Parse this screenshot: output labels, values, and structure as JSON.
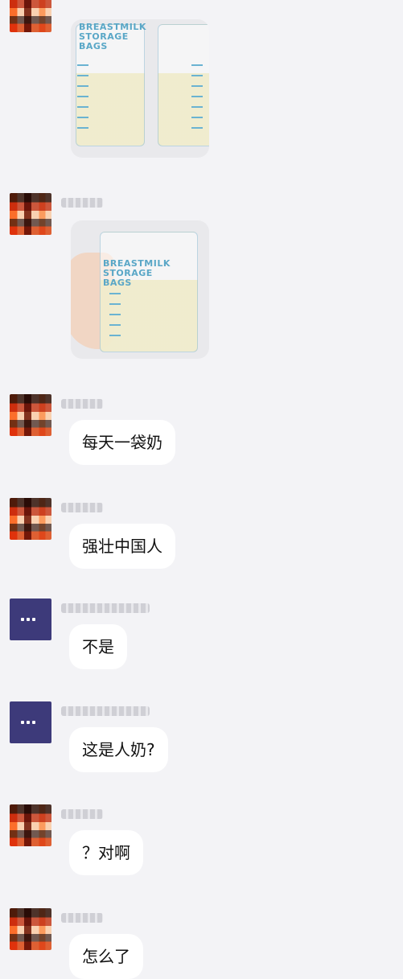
{
  "messages": [
    {
      "type": "image",
      "avatar": "pixelated-avatar",
      "image_text": "BREASTMILK STORAGE BAGS"
    },
    {
      "type": "image",
      "avatar": "pixelated-avatar",
      "image_text": "BREASTMILK STORAGE BAGS"
    },
    {
      "type": "text",
      "avatar": "pixelated-avatar",
      "text": "每天一袋奶"
    },
    {
      "type": "text",
      "avatar": "pixelated-avatar",
      "text": "强壮中国人"
    },
    {
      "type": "text",
      "avatar": "purple-avatar",
      "text": "不是"
    },
    {
      "type": "text",
      "avatar": "purple-avatar",
      "text": "这是人奶?"
    },
    {
      "type": "text",
      "avatar": "pixelated-avatar",
      "text": "？对啊"
    },
    {
      "type": "text",
      "avatar": "pixelated-avatar",
      "text": "怎么了"
    }
  ],
  "colors": {
    "background": "#f3f3f6",
    "bubble": "#ffffff",
    "purple_avatar": "#3d3a7a",
    "bag_print": "#5aa7c7"
  }
}
